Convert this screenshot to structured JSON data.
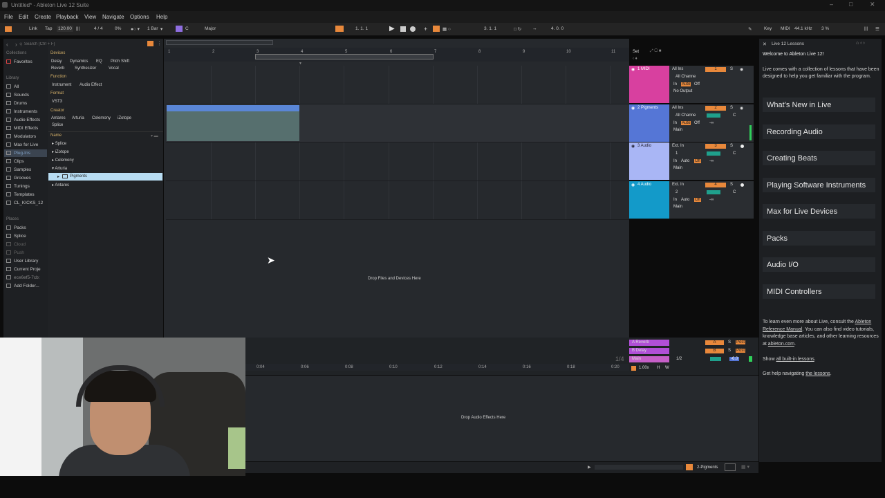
{
  "window": {
    "title": "Untitled* - Ableton Live 12 Suite",
    "controls": [
      "–",
      "□",
      "✕"
    ]
  },
  "menu": [
    "File",
    "Edit",
    "Create",
    "Playback",
    "View",
    "Navigate",
    "Options",
    "Help"
  ],
  "transport": {
    "link": "Link",
    "tap": "Tap",
    "tempo": "120.00",
    "signature": "4 / 4",
    "groove": "0%",
    "quantize": "1 Bar",
    "scale_root": "C",
    "scale_name": "Major",
    "position": "1.  1.  1",
    "loop_start": "3.  1.  1",
    "loop_length": "4.  0.  0",
    "key": "Key",
    "midi": "MIDI",
    "sample_rate": "44.1 kHz",
    "cpu": "3 %"
  },
  "browser": {
    "search_placeholder": "Search (Ctrl + F)",
    "collections_label": "Collections",
    "favorites": "Favorites",
    "library_label": "Library",
    "library": [
      "All",
      "Sounds",
      "Drums",
      "Instruments",
      "Audio Effects",
      "MIDI Effects",
      "Modulators",
      "Max for Live",
      "Plug-Ins",
      "Clips",
      "Samples",
      "Grooves",
      "Tunings",
      "Templates",
      "CL_KICKS_12"
    ],
    "places_label": "Places",
    "places": [
      "Packs",
      "Splice",
      "Cloud",
      "Push",
      "User Library",
      "Current Proje",
      "ece6ef5-7cb:",
      "Add Folder..."
    ],
    "filters": {
      "devices_label": "Devices",
      "devices": [
        "Delay",
        "Dynamics",
        "EQ",
        "Pitch Shift",
        "Reverb",
        "Synthesizer",
        "Vocal"
      ],
      "function_label": "Function",
      "function": [
        "Instrument",
        "Audio Effect"
      ],
      "format_label": "Format",
      "format": [
        "VST3"
      ],
      "creator_label": "Creator",
      "creator": [
        "Antares",
        "Arturia",
        "Celemony",
        "iZotope",
        "Splice"
      ]
    },
    "name_label": "Name",
    "tree": [
      "Splice",
      "iZotope",
      "Celemony",
      "Arturia",
      "Pigments",
      "Antares"
    ]
  },
  "arrangement": {
    "bars": [
      "1",
      "2",
      "3",
      "4",
      "5",
      "6",
      "7",
      "8",
      "9",
      "10",
      "11"
    ],
    "drop_label": "Drop Files and Devices Here",
    "tracks": [
      {
        "name": "1 MIDI",
        "input": "All Ins",
        "channel": "All Channe",
        "monitor": [
          "In",
          "Auto",
          "Off"
        ],
        "output": "No Output",
        "number": "1",
        "color": "#d8409f"
      },
      {
        "name": "2 Pigments",
        "input": "All Ins",
        "channel": "All Channe",
        "monitor": [
          "In",
          "Auto",
          "Off"
        ],
        "output": "Main",
        "number": "2",
        "vol": "-∞",
        "pan": "C",
        "color": "#5576d6"
      },
      {
        "name": "3 Audio",
        "input": "Ext. In",
        "channel": "1",
        "monitor": [
          "In",
          "Auto",
          "Off"
        ],
        "output": "Main",
        "number": "3",
        "vol": "-∞",
        "pan": "C",
        "color": "#a9b6f5"
      },
      {
        "name": "4 Audio",
        "input": "Ext. In",
        "channel": "2",
        "monitor": [
          "In",
          "Auto",
          "Off"
        ],
        "output": "Main",
        "number": "4",
        "vol": "-∞",
        "pan": "C",
        "color": "#139ac9"
      }
    ],
    "returns": [
      {
        "name": "A Reverb",
        "letter": "A",
        "color": "#b04fd6"
      },
      {
        "name": "B Delay",
        "letter": "B",
        "color": "#b04fd6"
      }
    ],
    "main": {
      "name": "Main",
      "fraction": "1/2",
      "volume": "-6.0",
      "color": "#c65fc8"
    },
    "quantization": "1/4",
    "time_ticks": [
      "0:04",
      "0:06",
      "0:08",
      "0:10",
      "0:12",
      "0:14",
      "0:16",
      "0:18",
      "0:20"
    ],
    "set_label": "Set",
    "speed": "1.00x",
    "h": "H",
    "w": "W",
    "post": "Post",
    "s": "S"
  },
  "device_view": {
    "drop_label": "Drop Audio Effects Here",
    "selected_track": "2-Pigments"
  },
  "lessons": {
    "header": "Live 12 Lessons",
    "welcome": "Welcome to Ableton Live 12!",
    "intro": "Live comes with a collection of lessons that have been designed to help you get familiar with the program.",
    "items": [
      "What’s New in Live",
      "Recording Audio",
      "Creating Beats",
      "Playing Software Instruments",
      "Max for Live Devices",
      "Packs",
      "Audio I/O",
      "MIDI Controllers"
    ],
    "footer_a": "To learn even more about Live, consult the",
    "manual_link": "Ableton Reference Manual",
    "footer_b": ". You can also find video tutorials, knowledge base articles, and other learning resources at",
    "site_link": "ableton.com",
    "show_prefix": "Show ",
    "show_link": "all built-in lessons",
    "help_prefix": "Get help navigating ",
    "help_link": "the lessons"
  }
}
